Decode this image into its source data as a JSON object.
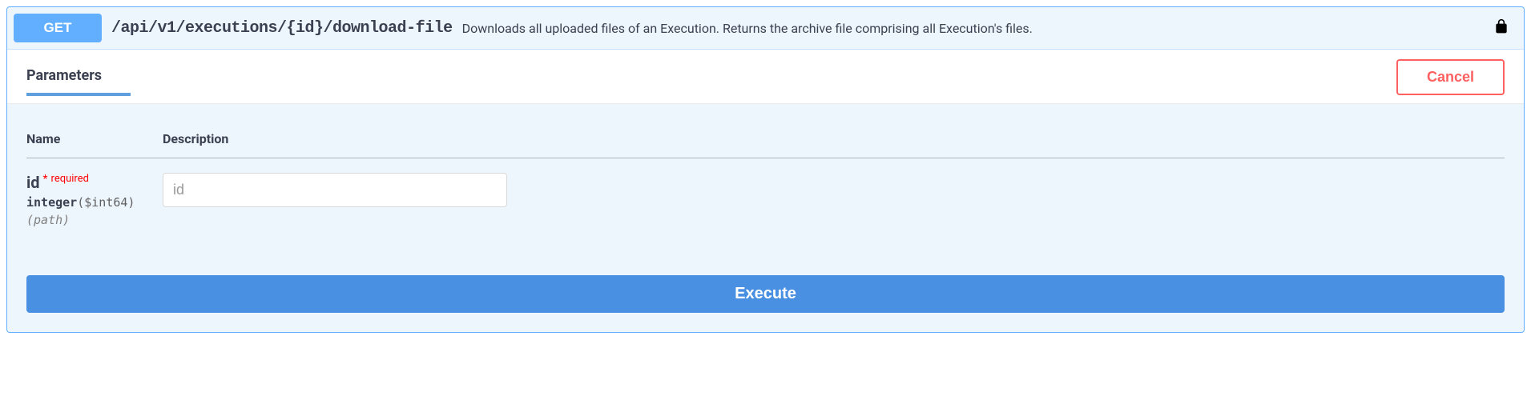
{
  "method": "GET",
  "path": "/api/v1/executions/{id}/download-file",
  "summary": "Downloads all uploaded files of an Execution. Returns the archive file comprising all Execution's files.",
  "tabs": {
    "parameters_label": "Parameters",
    "cancel_label": "Cancel"
  },
  "columns": {
    "name": "Name",
    "description": "Description"
  },
  "param": {
    "name": "id",
    "required_star": "*",
    "required_text": "required",
    "type": "integer",
    "format": "($int64)",
    "in": "(path)",
    "placeholder": "id"
  },
  "execute_label": "Execute"
}
